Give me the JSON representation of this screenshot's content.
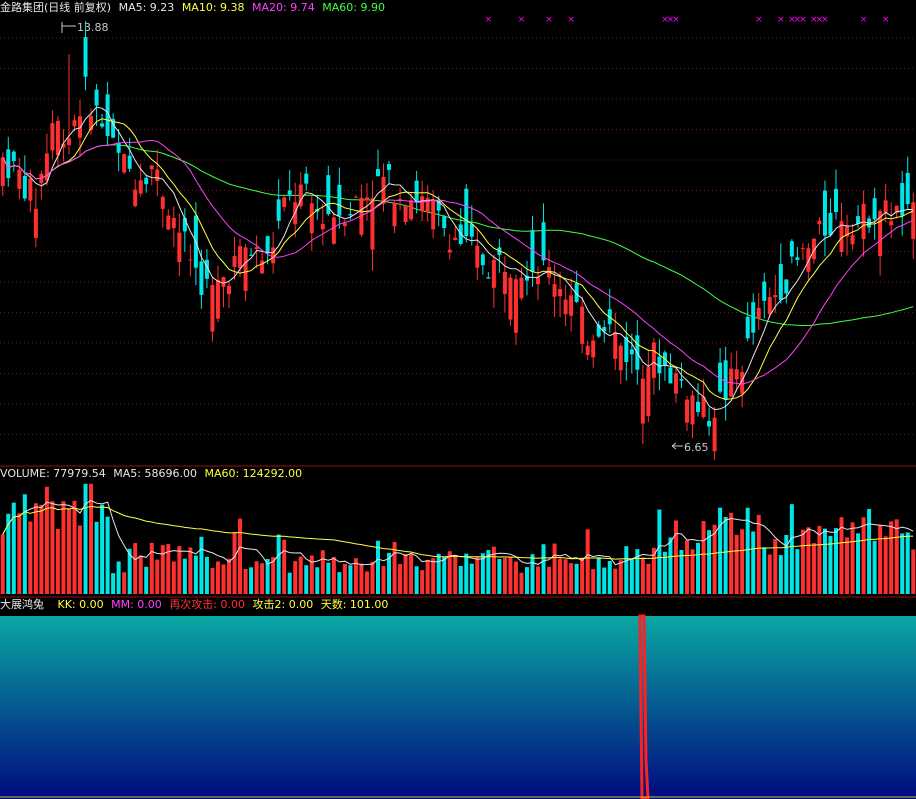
{
  "price_header": {
    "title": "金路集团(日线 前复权)",
    "ma5": "MA5: 9.23",
    "ma10": "MA10: 9.38",
    "ma20": "MA20: 9.74",
    "ma60": "MA60: 9.90"
  },
  "volume_header": {
    "volume": "VOLUME: 77979.54",
    "ma5": "MA5: 58696.00",
    "ma60": "MA60: 124292.00"
  },
  "indicator_header": {
    "name": "大展鸿兔",
    "kk": "KK: 0.00",
    "mm": "MM: 0.00",
    "zaici": "再次攻击: 0.00",
    "gongji2": "攻击2: 0.00",
    "tianshu": "天数: 101.00"
  },
  "annotations": {
    "high": "13.88",
    "low": "6.65"
  },
  "colors": {
    "up": "#ff3030",
    "down": "#00e6e6",
    "ma5": "#e6e6e6",
    "ma10": "#ffff40",
    "ma20": "#ff40ff",
    "ma60": "#40ff40",
    "grid": "#7a1010",
    "signal": "#ff00ff",
    "indicator_top": "#0aa7a2",
    "indicator_bottom": "#000a80",
    "indicator_spike": "#ff2020"
  },
  "chart_data": [
    {
      "type": "candlestick",
      "title": "金路集团(日线 前复权)",
      "ylim": [
        6.2,
        14.6
      ],
      "price_anchors": [
        [
          0,
          11.9
        ],
        [
          3,
          11.6
        ],
        [
          6,
          11.1
        ],
        [
          9,
          12.6
        ],
        [
          12,
          12.4
        ],
        [
          15,
          13.2
        ],
        [
          18,
          12.6
        ],
        [
          21,
          11.9
        ],
        [
          24,
          11.6
        ],
        [
          27,
          11.8
        ],
        [
          30,
          11.1
        ],
        [
          33,
          10.3
        ],
        [
          36,
          9.6
        ],
        [
          38,
          9.4
        ],
        [
          41,
          9.8
        ],
        [
          44,
          10.2
        ],
        [
          48,
          10.0
        ],
        [
          51,
          11.0
        ],
        [
          54,
          11.3
        ],
        [
          57,
          10.9
        ],
        [
          60,
          10.9
        ],
        [
          63,
          11.0
        ],
        [
          66,
          11.3
        ],
        [
          69,
          11.5
        ],
        [
          72,
          11.3
        ],
        [
          75,
          11.2
        ],
        [
          78,
          10.9
        ],
        [
          81,
          10.5
        ],
        [
          85,
          10.2
        ],
        [
          88,
          9.9
        ],
        [
          91,
          10.0
        ],
        [
          94,
          9.9
        ],
        [
          97,
          9.9
        ],
        [
          100,
          9.7
        ],
        [
          103,
          9.3
        ],
        [
          106,
          8.6
        ],
        [
          109,
          8.9
        ],
        [
          112,
          8.4
        ],
        [
          115,
          8.0
        ],
        [
          118,
          8.2
        ],
        [
          121,
          7.9
        ],
        [
          124,
          7.6
        ],
        [
          126,
          7.2
        ],
        [
          128,
          7.1
        ],
        [
          131,
          7.5
        ],
        [
          134,
          8.1
        ],
        [
          137,
          8.9
        ],
        [
          140,
          9.4
        ],
        [
          143,
          9.8
        ],
        [
          146,
          10.2
        ],
        [
          149,
          10.6
        ],
        [
          152,
          10.9
        ],
        [
          155,
          10.7
        ],
        [
          158,
          11.0
        ],
        [
          161,
          10.9
        ],
        [
          165,
          10.8
        ]
      ],
      "high": 13.88,
      "low": 6.65,
      "ma_last": {
        "MA5": 9.23,
        "MA10": 9.38,
        "MA20": 9.74,
        "MA60": 9.9
      }
    },
    {
      "type": "bar",
      "title": "VOLUME",
      "ylim": [
        0,
        200000
      ],
      "series": [
        {
          "name": "VOLUME",
          "last": 77979.54
        },
        {
          "name": "MA5",
          "last": 58696.0
        },
        {
          "name": "MA60",
          "last": 124292.0
        }
      ]
    },
    {
      "type": "area",
      "title": "大展鸿兔",
      "series": [
        {
          "name": "KK",
          "last": 0.0
        },
        {
          "name": "MM",
          "last": 0.0
        },
        {
          "name": "再次攻击",
          "last": 0.0
        },
        {
          "name": "攻击2",
          "last": 0.0
        },
        {
          "name": "天数",
          "last": 101.0
        }
      ]
    }
  ]
}
